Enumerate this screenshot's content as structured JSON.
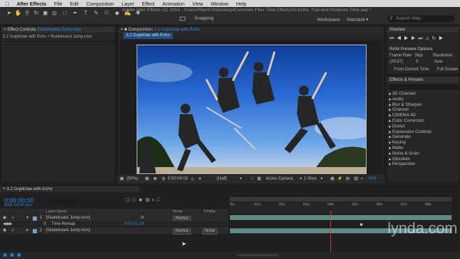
{
  "menubar": {
    "apple": "",
    "app": "After Effects",
    "file": "File",
    "edit": "Edit",
    "composition": "Composition",
    "layer": "Layer",
    "effect": "Effect",
    "animation": "Animation",
    "view": "View",
    "window": "Window",
    "help": "Help"
  },
  "window_title": "Adobe After Effects CC 2014 - /Users/SternFX/Desktop/Exercises Files Time Effects/03 Echo, Trail and Posterize Time.aep *",
  "toolbar": {
    "snapping": "Snapping",
    "workspace_label": "Workspace:",
    "workspace_value": "Standard",
    "search_placeholder": "Search Help"
  },
  "left_panel": {
    "tab_prefix": "Effect Controls",
    "tab_file": "Skateboard Jump.mov",
    "breadcrumb": "3.2 Duplictae with Echo • Skateboard Jump.mov"
  },
  "composition": {
    "tab_prefix": "Composition",
    "tab_name": "3.2 Duplictae with Echo",
    "subtab": "3.2 Duplictae with Echo",
    "zoom": "(50%)",
    "timecode": "0:00:04:03",
    "resolution": "(Half)",
    "camera": "Active Camera",
    "views": "1 View",
    "exposure": "+0.0"
  },
  "preview": {
    "title": "Preview",
    "ram_options": "RAM Preview Options",
    "frame_rate_label": "Frame Rate",
    "skip_label": "Skip",
    "resolution_label": "Resolution",
    "frame_rate_value": "(29.97)",
    "skip_value": "0",
    "resolution_value": "Auto",
    "from_current": "From Current Time",
    "full_screen": "Full Screen"
  },
  "effects_presets": {
    "title": "Effects & Presets",
    "items": [
      "3D Channel",
      "Audio",
      "Blur & Sharpen",
      "Channel",
      "CINEMA 4D",
      "Color Correction",
      "Distort",
      "Expression Controls",
      "Generate",
      "Keying",
      "Matte",
      "Noise & Grain",
      "Obsolete",
      "Perspective"
    ]
  },
  "timeline": {
    "tab_name": "3.2 Duplictae with Echo",
    "timecode": "0:00:00:00",
    "fps": "0000 (29.97 fps)",
    "col_layer_name": "Layer Name",
    "col_mode": "Mode",
    "col_trkmat": "TrkMat",
    "layers": [
      {
        "num": "1",
        "name": "[Skateboard Jump.mov]",
        "mode": "Norma"
      },
      {
        "num": "2",
        "name": "[Skateboard Jump.mov]",
        "mode": "Norma",
        "trkmat": "None"
      }
    ],
    "time_remap_label": "Time Remap",
    "time_remap_value": "0:00:01:24",
    "ruler": [
      "0s",
      "01s",
      "02s",
      "03s",
      "04s",
      "05s",
      "06s",
      "07s",
      "08s"
    ]
  },
  "watermark": "lynda.com"
}
